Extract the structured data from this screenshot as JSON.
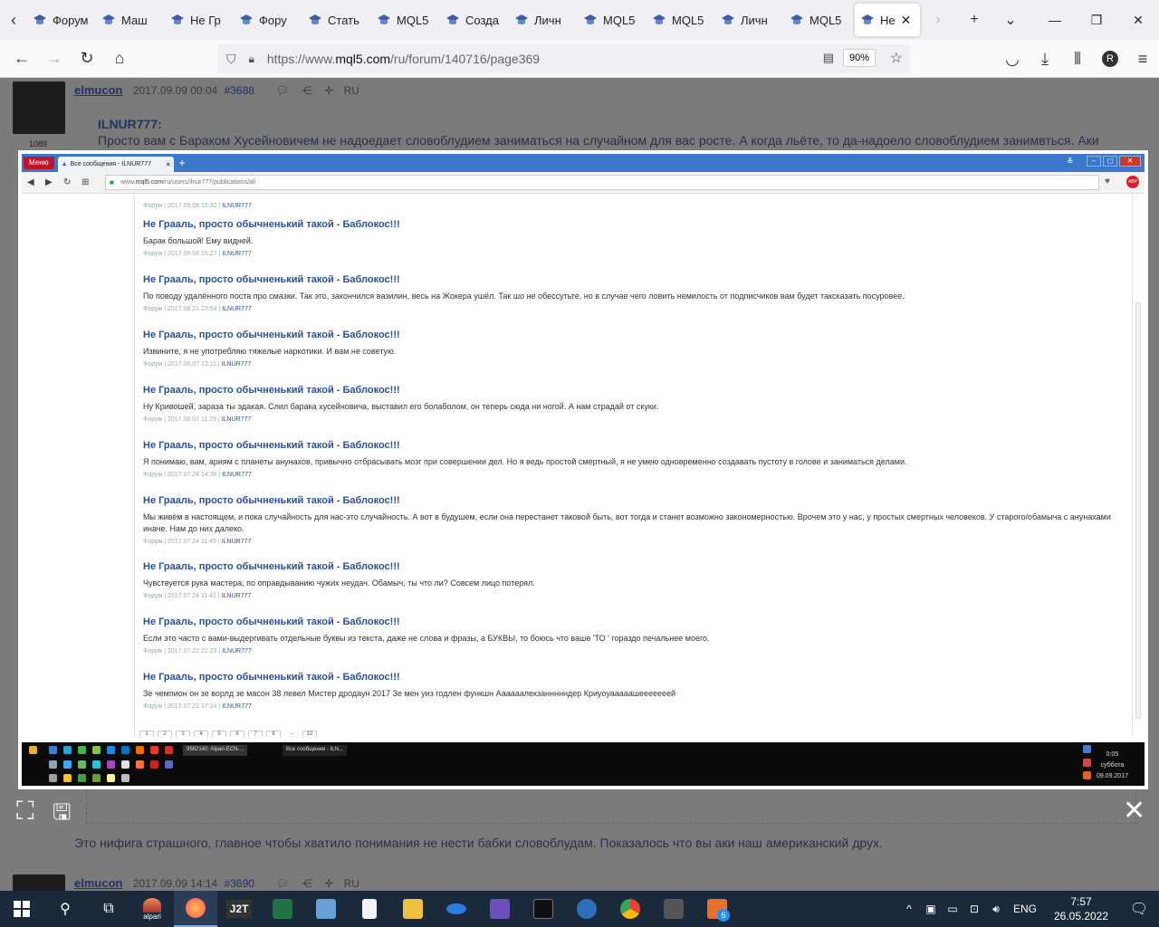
{
  "browser": {
    "tabs": [
      {
        "label": "Форум"
      },
      {
        "label": "Маш"
      },
      {
        "label": "Не Гр"
      },
      {
        "label": "Фору"
      },
      {
        "label": "Стать"
      },
      {
        "label": "MQL5"
      },
      {
        "label": "Созда"
      },
      {
        "label": "Личн"
      },
      {
        "label": "MQL5"
      },
      {
        "label": "MQL5"
      },
      {
        "label": "Личн"
      },
      {
        "label": "MQL5"
      }
    ],
    "active_tab": "Не",
    "url_prefix": "https://www.",
    "url_domain": "mql5.com",
    "url_path": "/ru/forum/140716/page369",
    "zoom": "90%",
    "profile_initial": "R"
  },
  "page": {
    "post1": {
      "author": "elmucon",
      "date": "2017.09.09 00:04",
      "number": "#3688",
      "lang": "RU",
      "rating": "1089",
      "quote_name": "ILNUR777:",
      "quote_text": "Просто вам с Бараком Хусейновичем не надоедает словоблудием заниматься на случайном для вас росте. А когда льёте, то да-надоело словоблудием занимвться. Аки ветром сдувает. Сектанты-лишенеры)))))"
    },
    "reply_text": "Это нифига страшного, главное чтобы хватило понимания не нести бабки словоблудам. Показалось что вы аки наш американский друх.",
    "post2": {
      "author": "elmucon",
      "date": "2017.09.09 14:14",
      "number": "#3690",
      "lang": "RU"
    }
  },
  "lightbox": {
    "opera_label": "Меню",
    "tab_title": "Все сообщения - ILNUR777",
    "url_prefix": "www.",
    "url_domain": "mql5.com",
    "url_path": "/ru/users/ilnur777/publications/all",
    "top_meta": {
      "section": "Форум",
      "date": "2017.09.08 15:32",
      "user": "ILNUR777"
    },
    "publications": [
      {
        "title": "Не Грааль, просто обычненький такой - Баблокос!!!",
        "text": "Барак большой! Ему видней.",
        "section": "Форум",
        "date": "2017.09.08 15:27",
        "user": "ILNUR777"
      },
      {
        "title": "Не Грааль, просто обычненький такой - Баблокос!!!",
        "text": "По поводу удалённого поста про смазки. Так это, закончился вазилин, весь на Жокера ушёл. Так шо не обессутьте, но в случае чего ловить немилость от подписчиков вам будет таксказать посуровее.",
        "section": "Форум",
        "date": "2017.08.21 23:54",
        "user": "ILNUR777"
      },
      {
        "title": "Не Грааль, просто обычненький такой - Баблокос!!!",
        "text": "Извините, я не употребляю тяжелые наркотики. И вам не советую.",
        "section": "Форум",
        "date": "2017.08.07 13:11",
        "user": "ILNUR777"
      },
      {
        "title": "Не Грааль, просто обычненький такой - Баблокос!!!",
        "text": "Ну Кривошей, зараза ты эдакая. Слил барака хусейновича, выставил его болаболом, он теперь сюда ни ногой. А нам страдай от скуки.",
        "section": "Форум",
        "date": "2017.08.07 11:29",
        "user": "ILNUR777"
      },
      {
        "title": "Не Грааль, просто обычненький такой - Баблокос!!!",
        "text": "Я понимаю, вам, ариям с планеты анунахов, привычно отбрасывать мозг при совершении дел. Но я ведь простой смертный, я не умею одновременно создавать пустоту в голове и заниматься делами.",
        "section": "Форум",
        "date": "2017.07.24 14:36",
        "user": "ILNUR777"
      },
      {
        "title": "Не Грааль, просто обычненький такой - Баблокос!!!",
        "text": "Мы живём в настоящем, и пока случайность для нас-это случайность. А вот в будушем, если она перестанет таковой быть, вот тогда и станет возможно закономерностью. Врочем это у нас, у простых смертных человеков. У старого/обамыча с анунахами иначе. Нам до них далеко.",
        "section": "Форум",
        "date": "2017.07.24 11:45",
        "user": "ILNUR777"
      },
      {
        "title": "Не Грааль, просто обычненький такой - Баблокос!!!",
        "text": "Чувствуется рука мастера, по оправдыванию чужих неудач. Обамыч, ты что ли? Совсем лицо потерял.",
        "section": "Форум",
        "date": "2017.07.24 11:41",
        "user": "ILNUR777"
      },
      {
        "title": "Не Грааль, просто обычненький такой - Баблокос!!!",
        "text": "Если это часто с вами-выдергивать отдельные буквы из текста, даже не слова и фразы, а БУКВЫ, то боюсь что ваше 'ТО ' гораздо печальнее моего.",
        "section": "Форум",
        "date": "2017.07.22 22:23",
        "user": "ILNUR777"
      },
      {
        "title": "Не Грааль, просто обычненький такой - Баблокос!!!",
        "text": "Зе чемпион он зе ворлд зе масон 38 левел Мистер дродаун 2017 Зе мен уиз годлен функшн Аааааалекзаннннндер Криуоуааааашееееееей",
        "section": "Форум",
        "date": "2017.07.22 17:24",
        "user": "ILNUR777"
      }
    ],
    "pager": [
      "1",
      "2",
      "3",
      "4",
      "5",
      "6",
      "7",
      "8",
      "...",
      "12"
    ],
    "taskbar_items": [
      "9982140: Alpari-ECN-...",
      "Все сообщения - ILN..."
    ],
    "clock_time": "0:05",
    "clock_day": "суббота",
    "clock_date": "09.09.2017"
  },
  "windows_taskbar": {
    "lang": "ENG",
    "time": "7:57",
    "date": "26.05.2022",
    "app_label_j2t": "J2T",
    "alpari_label": "alpari",
    "badge": "6"
  }
}
